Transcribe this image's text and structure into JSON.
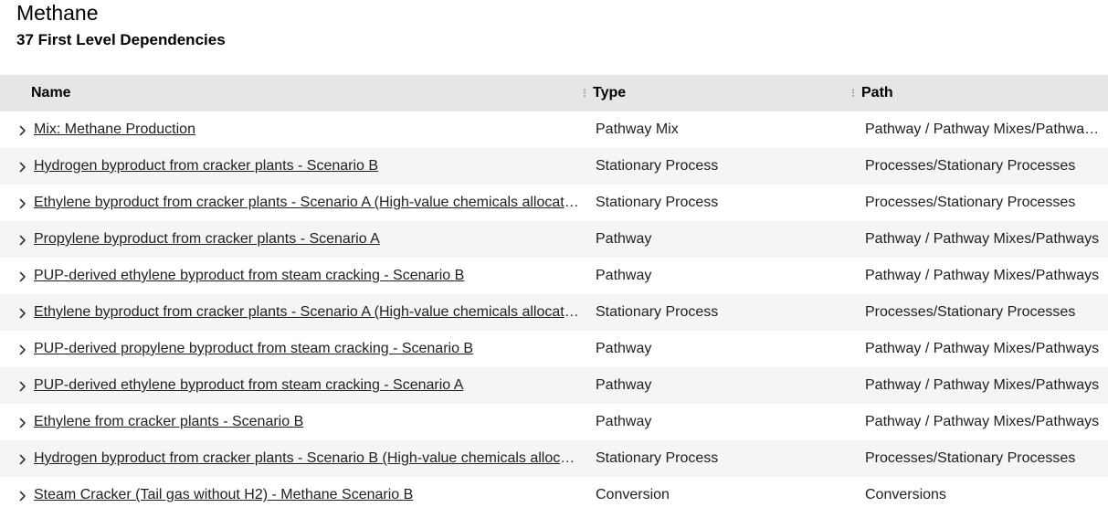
{
  "page": {
    "title": "Methane",
    "subtitle": "37 First Level Dependencies"
  },
  "table": {
    "columns": [
      "Name",
      "Type",
      "Path"
    ],
    "rows": [
      {
        "name": "Mix: Methane Production",
        "type": "Pathway Mix",
        "path": "Pathway / Pathway Mixes/Pathway Mixes"
      },
      {
        "name": "Hydrogen byproduct from cracker plants - Scenario B",
        "type": "Stationary Process",
        "path": "Processes/Stationary Processes"
      },
      {
        "name": "Ethylene byproduct from cracker plants - Scenario A (High-value chemicals allocation)",
        "type": "Stationary Process",
        "path": "Processes/Stationary Processes"
      },
      {
        "name": "Propylene byproduct from cracker plants - Scenario A",
        "type": "Pathway",
        "path": "Pathway / Pathway Mixes/Pathways"
      },
      {
        "name": "PUP-derived ethylene byproduct from steam cracking - Scenario B",
        "type": "Pathway",
        "path": "Pathway / Pathway Mixes/Pathways"
      },
      {
        "name": "Ethylene byproduct from cracker plants - Scenario A (High-value chemicals allocation)",
        "type": "Stationary Process",
        "path": "Processes/Stationary Processes"
      },
      {
        "name": "PUP-derived propylene byproduct from steam cracking - Scenario B",
        "type": "Pathway",
        "path": "Pathway / Pathway Mixes/Pathways"
      },
      {
        "name": "PUP-derived ethylene byproduct from steam cracking - Scenario A",
        "type": "Pathway",
        "path": "Pathway / Pathway Mixes/Pathways"
      },
      {
        "name": "Ethylene from cracker plants - Scenario B",
        "type": "Pathway",
        "path": "Pathway / Pathway Mixes/Pathways"
      },
      {
        "name": "Hydrogen byproduct from cracker plants - Scenario B (High-value chemicals allocation)",
        "type": "Stationary Process",
        "path": "Processes/Stationary Processes"
      },
      {
        "name": "Steam Cracker (Tail gas without H2) - Methane Scenario B",
        "type": "Conversion",
        "path": "Conversions"
      }
    ]
  },
  "icons": {
    "row_expander": "chevron-right-icon",
    "column_separator": "column-resize-handle"
  },
  "colors": {
    "header_background": "#e6e6e6",
    "alt_row_background": "#f5f5f5"
  }
}
